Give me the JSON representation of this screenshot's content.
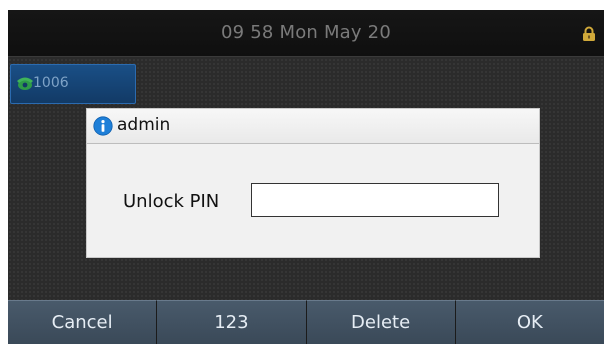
{
  "status_bar": {
    "time_text": "09 58 Mon May 20",
    "lock_icon": "lock-icon"
  },
  "line_key": {
    "label": "1006",
    "icon": "phone-handset-icon"
  },
  "dialog": {
    "title": "admin",
    "title_icon": "info-icon",
    "pin_label": "Unlock PIN",
    "pin_value": "",
    "pin_placeholder": ""
  },
  "softkeys": [
    {
      "label": "Cancel"
    },
    {
      "label": "123"
    },
    {
      "label": "Delete"
    },
    {
      "label": "OK"
    }
  ],
  "colors": {
    "screen_background": "#2b2b2b",
    "status_bar": "#111111",
    "line_key": "#1a4f86",
    "dialog_background": "#f1f1f1",
    "softkey": "#495a6b"
  }
}
